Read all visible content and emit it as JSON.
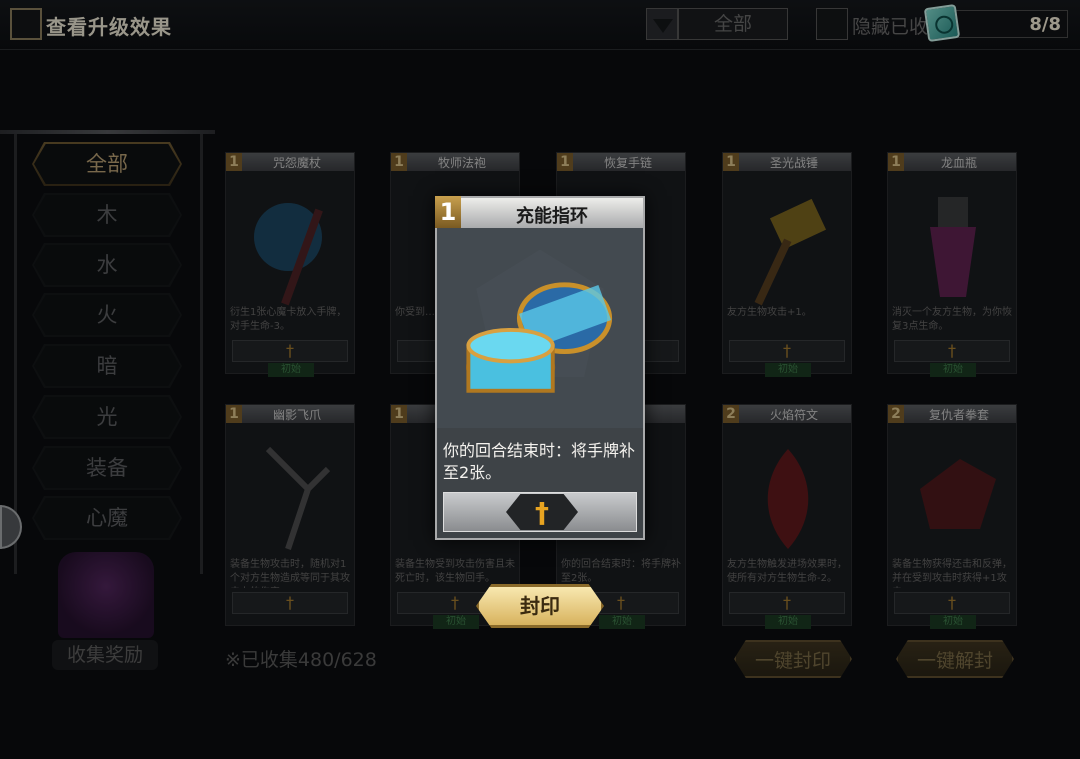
{
  "topbar": {
    "upgrade_label": "查看升级效果",
    "filter_value": "全部",
    "hide_label": "隐藏已收",
    "counter": "8/8"
  },
  "categories": [
    "全部",
    "木",
    "水",
    "火",
    "暗",
    "光",
    "装备",
    "心魔"
  ],
  "chest_label": "收集奖励",
  "collected_text": "※已收集480/628",
  "bulk_seal_label": "一键封印",
  "bulk_unseal_label": "一键解封",
  "seal_label": "封印",
  "cards": [
    {
      "cost": "1",
      "name": "咒怨魔杖",
      "desc": "衍生1张心魔卡放入手牌，对手生命-3。",
      "tag": "初始"
    },
    {
      "cost": "1",
      "name": "牧师法袍",
      "desc": "你受到…点生命。",
      "tag": ""
    },
    {
      "cost": "1",
      "name": "恢复手链",
      "desc": "…受过伤…开始时：",
      "tag": ""
    },
    {
      "cost": "1",
      "name": "圣光战锤",
      "desc": "友方生物攻击+1。",
      "tag": "初始"
    },
    {
      "cost": "1",
      "name": "龙血瓶",
      "desc": "消灭一个友方生物，为你恢复3点生命。",
      "tag": "初始"
    },
    {
      "cost": "1",
      "name": "幽影飞爪",
      "desc": "装备生物攻击时，随机对1个对方生物造成等同于其攻击力的伤害。",
      "tag": ""
    },
    {
      "cost": "1",
      "name": "眩…",
      "desc": "装备生物受到攻击伤害且未死亡时，该生物回手。",
      "tag": "初始"
    },
    {
      "cost": "1",
      "name": "…",
      "desc": "你的回合结束时：将手牌补至2张。",
      "tag": "初始"
    },
    {
      "cost": "2",
      "name": "火焰符文",
      "desc": "友方生物触发进场效果时，使所有对方生物生命-2。",
      "tag": "初始"
    },
    {
      "cost": "2",
      "name": "复仇者拳套",
      "desc": "装备生物获得还击和反弹，并在受到攻击时获得+1攻击。",
      "tag": "初始"
    }
  ],
  "popup": {
    "cost": "1",
    "name": "充能指环",
    "desc": "你的回合结束时：将手牌补至2张。"
  },
  "colors": {
    "accent_gold": "#d8b35e",
    "background": "#0b0d10"
  }
}
